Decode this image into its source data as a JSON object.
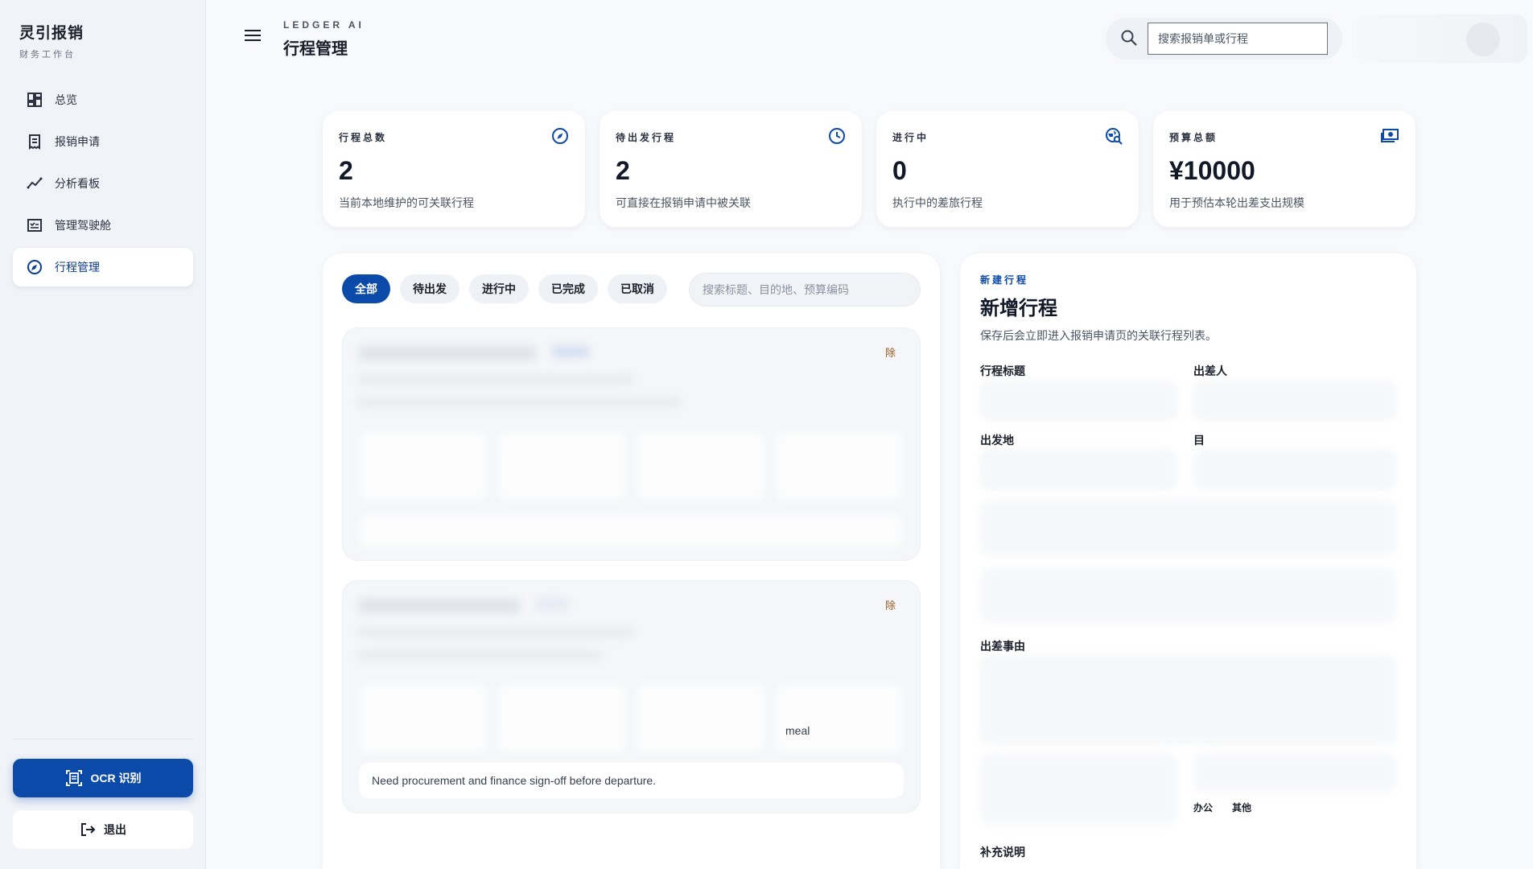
{
  "brand": {
    "name": "灵引报销",
    "subtitle": "财务工作台"
  },
  "nav": [
    {
      "label": "总览",
      "icon": "dashboard-icon"
    },
    {
      "label": "报销申请",
      "icon": "receipt-icon"
    },
    {
      "label": "分析看板",
      "icon": "trend-chart-icon"
    },
    {
      "label": "管理驾驶舱",
      "icon": "checklist-icon"
    },
    {
      "label": "行程管理",
      "icon": "compass-icon",
      "active": true
    }
  ],
  "ocr_button": "OCR 识别",
  "logout_button": "退出",
  "header": {
    "eyebrow": "LEDGER AI",
    "title": "行程管理",
    "search_placeholder": "搜索报销单或行程"
  },
  "stats": [
    {
      "label": "行程总数",
      "value": "2",
      "desc": "当前本地维护的可关联行程",
      "icon": "compass-icon"
    },
    {
      "label": "待出发行程",
      "value": "2",
      "desc": "可直接在报销申请中被关联",
      "icon": "clock-icon"
    },
    {
      "label": "进行中",
      "value": "0",
      "desc": "执行中的差旅行程",
      "icon": "travel-explore-icon"
    },
    {
      "label": "预算总额",
      "value": "¥10000",
      "desc": "用于预估本轮出差支出规模",
      "icon": "money-icon"
    }
  ],
  "filters": [
    "全部",
    "待出发",
    "进行中",
    "已完成",
    "已取消"
  ],
  "trip_search_placeholder": "搜索标题、目的地、预算编码",
  "trip_cards": [
    {
      "delete_label": "除"
    },
    {
      "delete_label": "除",
      "cell_text": "meal",
      "note": "Need procurement and finance sign-off before departure."
    }
  ],
  "form": {
    "eyebrow": "新建行程",
    "title": "新增行程",
    "desc": "保存后会立即进入报销申请页的关联行程列表。",
    "labels": {
      "title": "行程标题",
      "traveler": "出差人",
      "origin": "出发地",
      "destination": "目",
      "reason": "出差事由",
      "note": "补充说明"
    },
    "tags": [
      "办公",
      "其他"
    ]
  }
}
